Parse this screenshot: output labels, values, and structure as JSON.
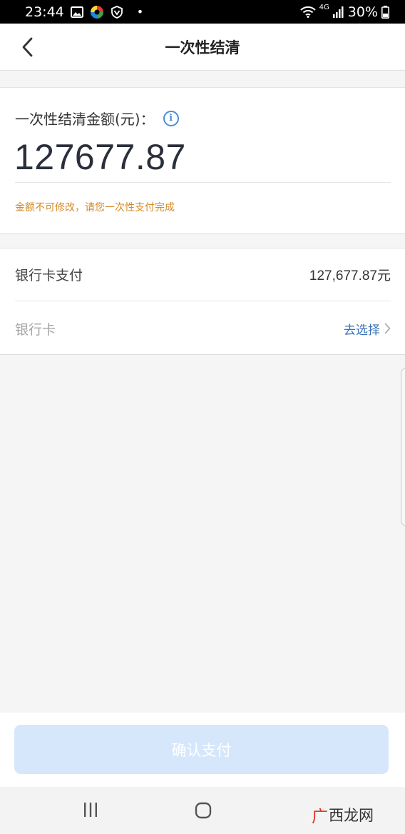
{
  "status_bar": {
    "time": "23:44",
    "network": "4G",
    "battery": "30%"
  },
  "nav": {
    "title": "一次性结清"
  },
  "amount_card": {
    "label": "一次性结清金额(元)：",
    "amount": "127677.87",
    "note": "金额不可修改，请您一次性支付完成"
  },
  "payment": {
    "method_label": "银行卡支付",
    "method_amount": "127,677.87元",
    "card_label": "银行卡",
    "card_action": "去选择"
  },
  "footer": {
    "confirm_label": "确认支付"
  },
  "watermark": {
    "mark": "广",
    "text": "西龙网"
  },
  "colors": {
    "accent_blue": "#4a8fd6",
    "link_blue": "#3a73b8",
    "note_orange": "#d38a24",
    "disabled_button": "#d6e7fb",
    "watermark_red": "#e0352b"
  },
  "icons": {
    "back": "chevron-left-icon",
    "info": "info-icon",
    "select_arrow": "chevron-right-icon",
    "gallery": "image-icon",
    "app": "app-badge-icon",
    "shield": "shield-icon",
    "wifi": "wifi-icon",
    "signal": "signal-icon",
    "battery": "battery-icon",
    "recent_apps": "recent-apps-icon",
    "home": "home-icon"
  }
}
